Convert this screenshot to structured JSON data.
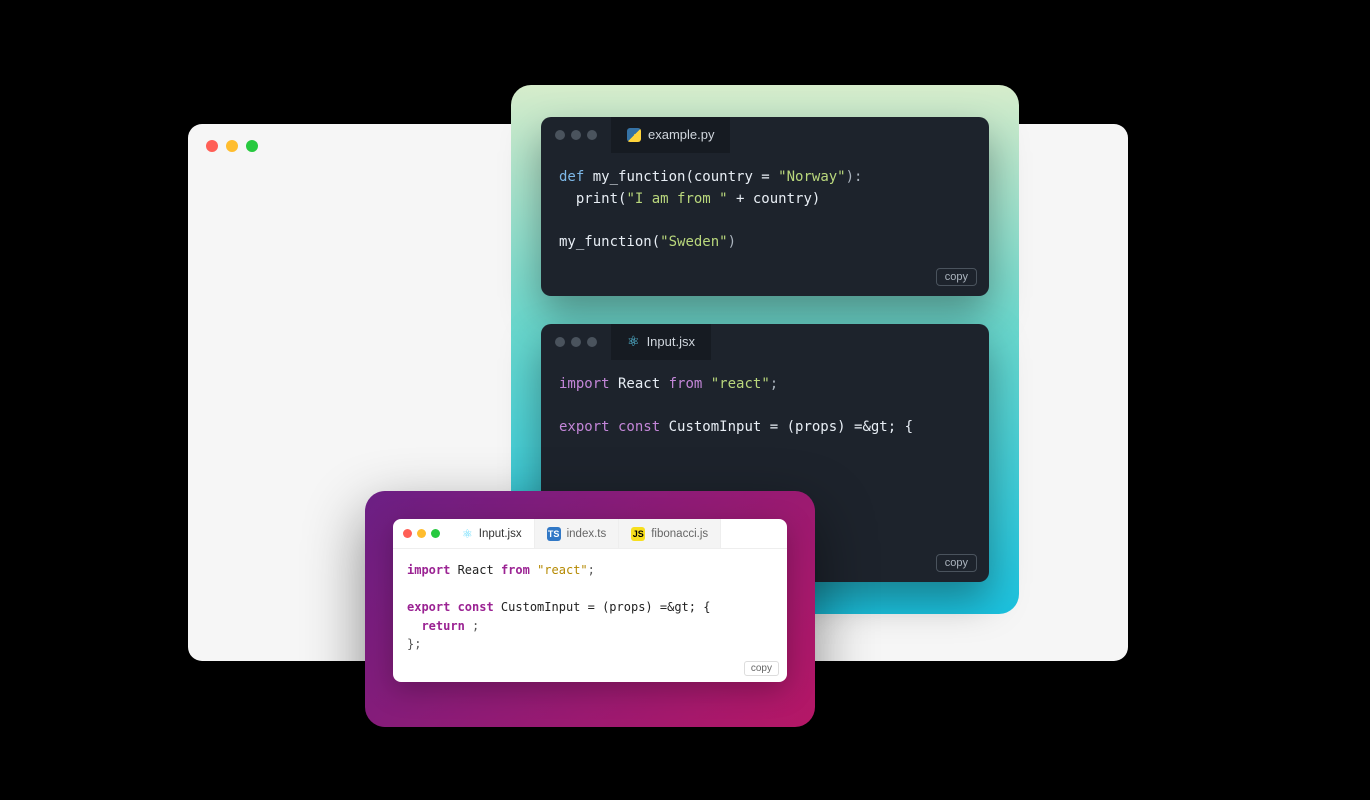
{
  "copy_label": "copy",
  "python_card": {
    "tab_label": "example.py",
    "line1_def": "def",
    "line1_name": " my_function(country = ",
    "line1_str": "\"Norway\"",
    "line1_end": "):",
    "line2_a": "  print(",
    "line2_str": "\"I am from \"",
    "line2_b": " + country)",
    "line4_a": "my_function(",
    "line4_str": "\"Sweden\"",
    "line4_b": ")"
  },
  "react_dark_card": {
    "tab_label": "Input.jsx",
    "line1_kw1": "import",
    "line1_id": " React ",
    "line1_kw2": "from",
    "line1_str": " \"react\"",
    "line1_end": ";",
    "line3_kw": "export const",
    "line3_rest": " CustomInput = (props) =&gt; {"
  },
  "light_card": {
    "tabs": [
      {
        "label": "Input.jsx",
        "icon": "react"
      },
      {
        "label": "index.ts",
        "icon": "ts"
      },
      {
        "label": "fibonacci.js",
        "icon": "js"
      }
    ],
    "line1_kw1": "import",
    "line1_id": " React ",
    "line1_kw2": "from",
    "line1_str": " \"react\"",
    "line1_end": ";",
    "line3_kw": "export const",
    "line3_rest": " CustomInput = (props) =&gt; {",
    "line4_kw": "  return",
    "line4_rest": " ;",
    "line5": "};"
  }
}
